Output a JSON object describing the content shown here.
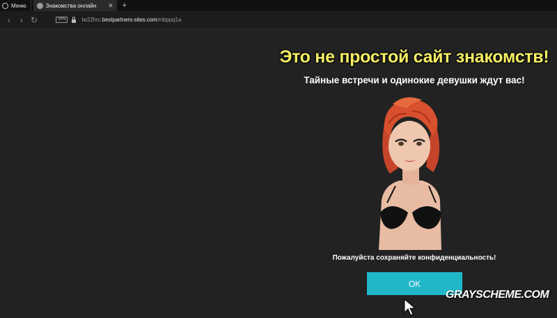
{
  "browser": {
    "menu_label": "Меню",
    "tab": {
      "title": "Знакомства онлайн",
      "close_glyph": "✕"
    },
    "new_tab_glyph": "+",
    "vpn_label": "VPN",
    "url_prefix": "tw22hrc.",
    "url_domain": "bestpartners-sites.com",
    "url_path": "/mbppq1a"
  },
  "page": {
    "headline": "Это не простой сайт знакомств!",
    "subheadline": "Тайные встречи и одинокие девушки ждут вас!",
    "privacy_notice": "Пожалуйста сохраняйте конфиденциальность!",
    "ok_label": "OK",
    "accent_color": "#20b8c9",
    "headline_color": "#f6ef64"
  },
  "watermark": "GRAYSCHEME.COM"
}
